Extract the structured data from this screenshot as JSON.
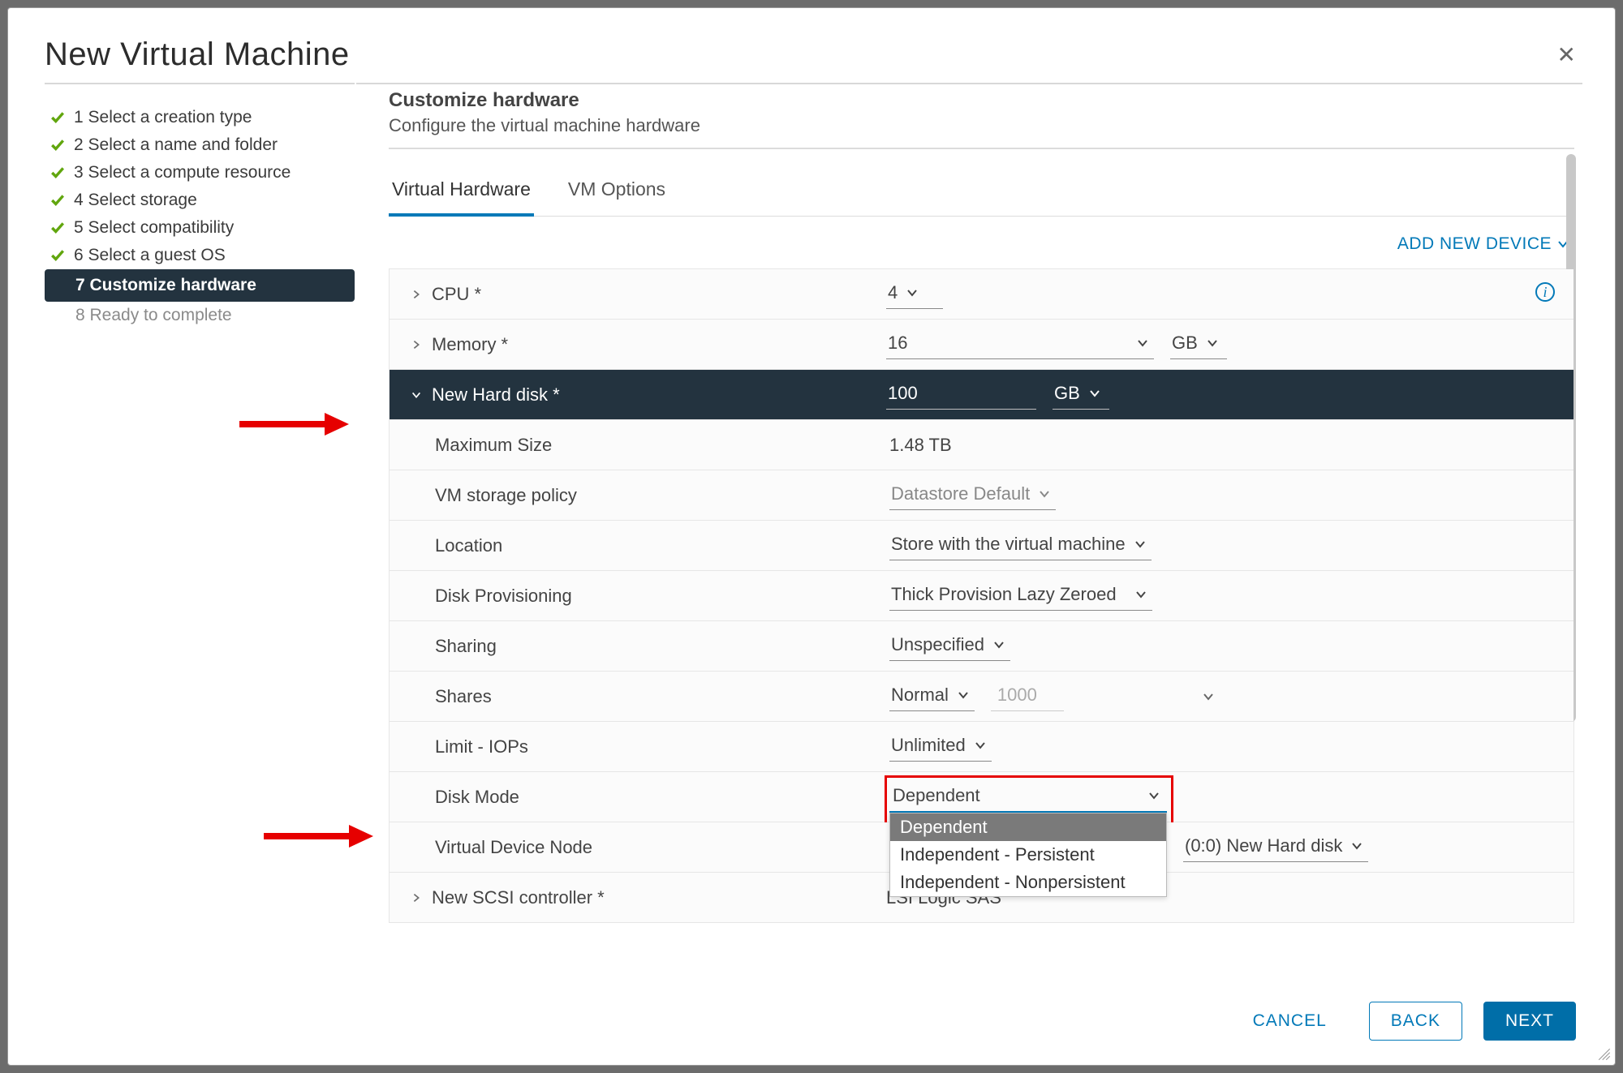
{
  "dialog_title": "New Virtual Machine",
  "steps": [
    {
      "num": "1",
      "label": "Select a creation type",
      "state": "completed"
    },
    {
      "num": "2",
      "label": "Select a name and folder",
      "state": "completed"
    },
    {
      "num": "3",
      "label": "Select a compute resource",
      "state": "completed"
    },
    {
      "num": "4",
      "label": "Select storage",
      "state": "completed"
    },
    {
      "num": "5",
      "label": "Select compatibility",
      "state": "completed"
    },
    {
      "num": "6",
      "label": "Select a guest OS",
      "state": "completed"
    },
    {
      "num": "7",
      "label": "Customize hardware",
      "state": "active"
    },
    {
      "num": "8",
      "label": "Ready to complete",
      "state": "pending"
    }
  ],
  "section": {
    "title": "Customize hardware",
    "subtitle": "Configure the virtual machine hardware"
  },
  "tabs": [
    {
      "label": "Virtual Hardware",
      "active": true
    },
    {
      "label": "VM Options",
      "active": false
    }
  ],
  "add_new_device": "ADD NEW DEVICE",
  "hw": {
    "cpu": {
      "label": "CPU *",
      "value": "4"
    },
    "memory": {
      "label": "Memory *",
      "value": "16",
      "unit": "GB"
    },
    "harddisk": {
      "label": "New Hard disk *",
      "value": "100",
      "unit": "GB"
    },
    "max_size": {
      "label": "Maximum Size",
      "value": "1.48 TB"
    },
    "storage_policy": {
      "label": "VM storage policy",
      "value": "Datastore Default"
    },
    "location": {
      "label": "Location",
      "value": "Store with the virtual machine"
    },
    "disk_prov": {
      "label": "Disk Provisioning",
      "value": "Thick Provision Lazy Zeroed"
    },
    "sharing": {
      "label": "Sharing",
      "value": "Unspecified"
    },
    "shares": {
      "label": "Shares",
      "value": "Normal",
      "num": "1000"
    },
    "limit_iops": {
      "label": "Limit - IOPs",
      "value": "Unlimited"
    },
    "disk_mode": {
      "label": "Disk Mode",
      "value": "Dependent",
      "options": [
        "Dependent",
        "Independent - Persistent",
        "Independent - Nonpersistent"
      ]
    },
    "vdn": {
      "label": "Virtual Device Node",
      "value": "(0:0) New Hard disk"
    },
    "scsi": {
      "label": "New SCSI controller *",
      "value": "LSI Logic SAS"
    }
  },
  "footer": {
    "cancel": "CANCEL",
    "back": "BACK",
    "next": "NEXT"
  }
}
